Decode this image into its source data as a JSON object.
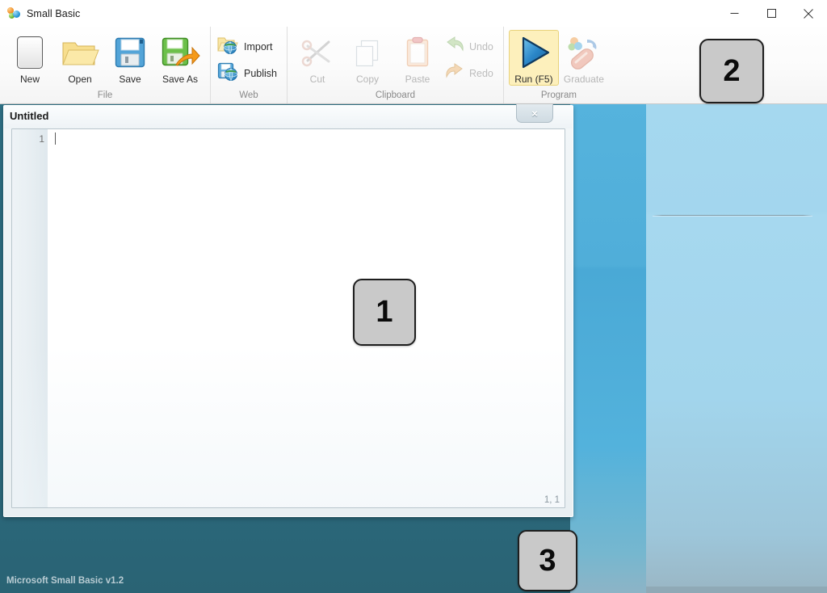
{
  "window": {
    "app_title": "Small Basic",
    "app_icon": "small-basic-logo-icon",
    "controls": {
      "minimize": "minimize-icon",
      "maximize": "maximize-icon",
      "close": "close-icon"
    }
  },
  "ribbon": {
    "groups": [
      {
        "label": "File",
        "buttons": [
          {
            "label": "New",
            "icon": "new-document-icon",
            "enabled": true
          },
          {
            "label": "Open",
            "icon": "open-folder-icon",
            "enabled": true
          },
          {
            "label": "Save",
            "icon": "floppy-disk-icon",
            "enabled": true
          },
          {
            "label": "Save As",
            "icon": "save-as-arrow-icon",
            "enabled": true
          }
        ]
      },
      {
        "label": "Web",
        "buttons": [
          {
            "label": "Import",
            "icon": "import-globe-folder-icon",
            "enabled": true
          },
          {
            "label": "Publish",
            "icon": "publish-globe-disk-icon",
            "enabled": true
          }
        ]
      },
      {
        "label": "Clipboard",
        "buttons": [
          {
            "label": "Cut",
            "icon": "scissors-icon",
            "enabled": false
          },
          {
            "label": "Copy",
            "icon": "copy-pages-icon",
            "enabled": false
          },
          {
            "label": "Paste",
            "icon": "clipboard-icon",
            "enabled": false
          },
          {
            "label": "Undo",
            "icon": "undo-arrow-icon",
            "enabled": false
          },
          {
            "label": "Redo",
            "icon": "redo-arrow-icon",
            "enabled": false
          }
        ]
      },
      {
        "label": "Program",
        "buttons": [
          {
            "label": "Run (F5)",
            "icon": "play-triangle-icon",
            "enabled": true,
            "highlighted": true
          },
          {
            "label": "Graduate",
            "icon": "graduate-bridge-icon",
            "enabled": false
          }
        ]
      }
    ]
  },
  "editor": {
    "document_title": "Untitled",
    "close_label": "×",
    "line_numbers": [
      "1"
    ],
    "code_text": "",
    "cursor_position": "1, 1"
  },
  "status": {
    "text": "Microsoft Small Basic v1.2"
  },
  "markers": {
    "one": "1",
    "two": "2",
    "three": "3"
  },
  "colors": {
    "run_highlight": "#fdf0bc",
    "desktop_dark": "#2d6c80",
    "desktop_mid": "#50aed9",
    "desktop_light": "#a3d6ee",
    "marker_fill": "#c9c9c9"
  }
}
